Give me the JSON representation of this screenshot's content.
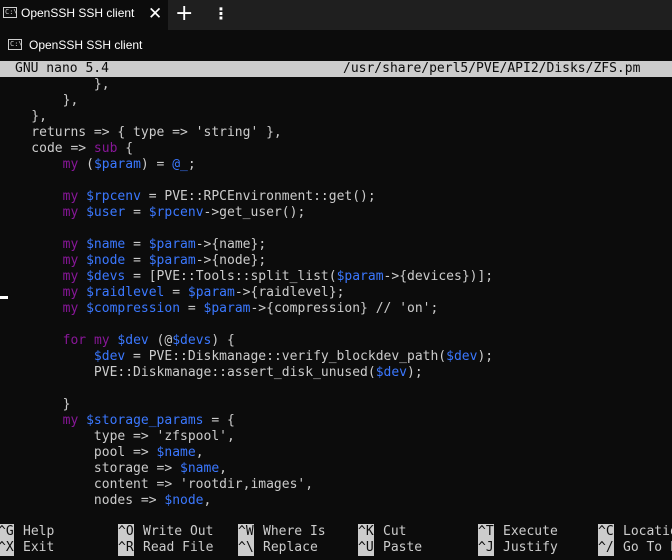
{
  "colors": {
    "default": "#cccccc",
    "keyword": "#881798",
    "variable": "#3b78ff",
    "plain": "#cccccc"
  },
  "tab": {
    "title": "OpenSSH SSH client",
    "close": "✕",
    "new_tab": "+",
    "menu": "⋮"
  },
  "window": {
    "title": "OpenSSH SSH client"
  },
  "nano": {
    "version": "GNU nano 5.4",
    "path": "/usr/share/perl5/PVE/API2/Disks/ZFS.pm"
  },
  "code": [
    [
      {
        "t": "            },",
        "c": "default"
      }
    ],
    [
      {
        "t": "        },",
        "c": "default"
      }
    ],
    [
      {
        "t": "    },",
        "c": "default"
      }
    ],
    [
      {
        "t": "    returns => { type => 'string' },",
        "c": "default"
      }
    ],
    [
      {
        "t": "    code => ",
        "c": "default"
      },
      {
        "t": "sub",
        "c": "keyword"
      },
      {
        "t": " {",
        "c": "default"
      }
    ],
    [
      {
        "t": "        ",
        "c": "default"
      },
      {
        "t": "my",
        "c": "keyword"
      },
      {
        "t": " (",
        "c": "default"
      },
      {
        "t": "$param",
        "c": "variable"
      },
      {
        "t": ") = ",
        "c": "default"
      },
      {
        "t": "@_",
        "c": "variable"
      },
      {
        "t": ";",
        "c": "default"
      }
    ],
    [
      {
        "t": "",
        "c": "default"
      }
    ],
    [
      {
        "t": "        ",
        "c": "default"
      },
      {
        "t": "my",
        "c": "keyword"
      },
      {
        "t": " ",
        "c": "default"
      },
      {
        "t": "$rpcenv",
        "c": "variable"
      },
      {
        "t": " = PVE::RPCEnvironment::get();",
        "c": "default"
      }
    ],
    [
      {
        "t": "        ",
        "c": "default"
      },
      {
        "t": "my",
        "c": "keyword"
      },
      {
        "t": " ",
        "c": "default"
      },
      {
        "t": "$user",
        "c": "variable"
      },
      {
        "t": " = ",
        "c": "default"
      },
      {
        "t": "$rpcenv",
        "c": "variable"
      },
      {
        "t": "->get_user();",
        "c": "default"
      }
    ],
    [
      {
        "t": "",
        "c": "default"
      }
    ],
    [
      {
        "t": "        ",
        "c": "default"
      },
      {
        "t": "my",
        "c": "keyword"
      },
      {
        "t": " ",
        "c": "default"
      },
      {
        "t": "$name",
        "c": "variable"
      },
      {
        "t": " = ",
        "c": "default"
      },
      {
        "t": "$param",
        "c": "variable"
      },
      {
        "t": "->{name};",
        "c": "default"
      }
    ],
    [
      {
        "t": "        ",
        "c": "default"
      },
      {
        "t": "my",
        "c": "keyword"
      },
      {
        "t": " ",
        "c": "default"
      },
      {
        "t": "$node",
        "c": "variable"
      },
      {
        "t": " = ",
        "c": "default"
      },
      {
        "t": "$param",
        "c": "variable"
      },
      {
        "t": "->{node};",
        "c": "default"
      }
    ],
    [
      {
        "t": "        ",
        "c": "default"
      },
      {
        "t": "my",
        "c": "keyword"
      },
      {
        "t": " ",
        "c": "default"
      },
      {
        "t": "$devs",
        "c": "variable"
      },
      {
        "t": " = [PVE::Tools::split_list(",
        "c": "default"
      },
      {
        "t": "$param",
        "c": "variable"
      },
      {
        "t": "->{devices})];",
        "c": "default"
      }
    ],
    [
      {
        "t": "        ",
        "c": "default"
      },
      {
        "t": "my",
        "c": "keyword"
      },
      {
        "t": " ",
        "c": "default"
      },
      {
        "t": "$raidlevel",
        "c": "variable"
      },
      {
        "t": " = ",
        "c": "default"
      },
      {
        "t": "$param",
        "c": "variable"
      },
      {
        "t": "->{raidlevel};",
        "c": "default"
      }
    ],
    [
      {
        "t": "        ",
        "c": "default"
      },
      {
        "t": "my",
        "c": "keyword"
      },
      {
        "t": " ",
        "c": "default"
      },
      {
        "t": "$compression",
        "c": "variable"
      },
      {
        "t": " = ",
        "c": "default"
      },
      {
        "t": "$param",
        "c": "variable"
      },
      {
        "t": "->{compression} // 'on';",
        "c": "default"
      }
    ],
    [
      {
        "t": "",
        "c": "default"
      }
    ],
    [
      {
        "t": "        ",
        "c": "default"
      },
      {
        "t": "for",
        "c": "keyword"
      },
      {
        "t": " ",
        "c": "default"
      },
      {
        "t": "my",
        "c": "keyword"
      },
      {
        "t": " ",
        "c": "default"
      },
      {
        "t": "$dev",
        "c": "variable"
      },
      {
        "t": " (@",
        "c": "default"
      },
      {
        "t": "$devs",
        "c": "variable"
      },
      {
        "t": ") {",
        "c": "default"
      }
    ],
    [
      {
        "t": "            ",
        "c": "default"
      },
      {
        "t": "$dev",
        "c": "variable"
      },
      {
        "t": " = PVE::Diskmanage::verify_blockdev_path(",
        "c": "default"
      },
      {
        "t": "$dev",
        "c": "variable"
      },
      {
        "t": ");",
        "c": "default"
      }
    ],
    [
      {
        "t": "            PVE::Diskmanage::assert_disk_unused(",
        "c": "default"
      },
      {
        "t": "$dev",
        "c": "variable"
      },
      {
        "t": ");",
        "c": "default"
      }
    ],
    [
      {
        "t": "",
        "c": "default"
      }
    ],
    [
      {
        "t": "        }",
        "c": "default"
      }
    ],
    [
      {
        "t": "        ",
        "c": "default"
      },
      {
        "t": "my",
        "c": "keyword"
      },
      {
        "t": " ",
        "c": "default"
      },
      {
        "t": "$storage_params",
        "c": "variable"
      },
      {
        "t": " = {",
        "c": "default"
      }
    ],
    [
      {
        "t": "            type => 'zfspool',",
        "c": "default"
      }
    ],
    [
      {
        "t": "            pool => ",
        "c": "default"
      },
      {
        "t": "$name",
        "c": "variable"
      },
      {
        "t": ",",
        "c": "default"
      }
    ],
    [
      {
        "t": "            storage => ",
        "c": "default"
      },
      {
        "t": "$name",
        "c": "variable"
      },
      {
        "t": ",",
        "c": "default"
      }
    ],
    [
      {
        "t": "            content => 'rootdir,images',",
        "c": "default"
      }
    ],
    [
      {
        "t": "            nodes => ",
        "c": "default"
      },
      {
        "t": "$node",
        "c": "variable"
      },
      {
        "t": ",",
        "c": "default"
      }
    ]
  ],
  "shortcuts": {
    "row1": [
      {
        "key": "^G",
        "label": "Help"
      },
      {
        "key": "^O",
        "label": "Write Out"
      },
      {
        "key": "^W",
        "label": "Where Is"
      },
      {
        "key": "^K",
        "label": "Cut"
      },
      {
        "key": "^T",
        "label": "Execute"
      },
      {
        "key": "^C",
        "label": "Location"
      }
    ],
    "row2": [
      {
        "key": "^X",
        "label": "Exit"
      },
      {
        "key": "^R",
        "label": "Read File"
      },
      {
        "key": "^\\",
        "label": "Replace"
      },
      {
        "key": "^U",
        "label": "Paste"
      },
      {
        "key": "^J",
        "label": "Justify"
      },
      {
        "key": "^/",
        "label": "Go To Line"
      }
    ]
  }
}
